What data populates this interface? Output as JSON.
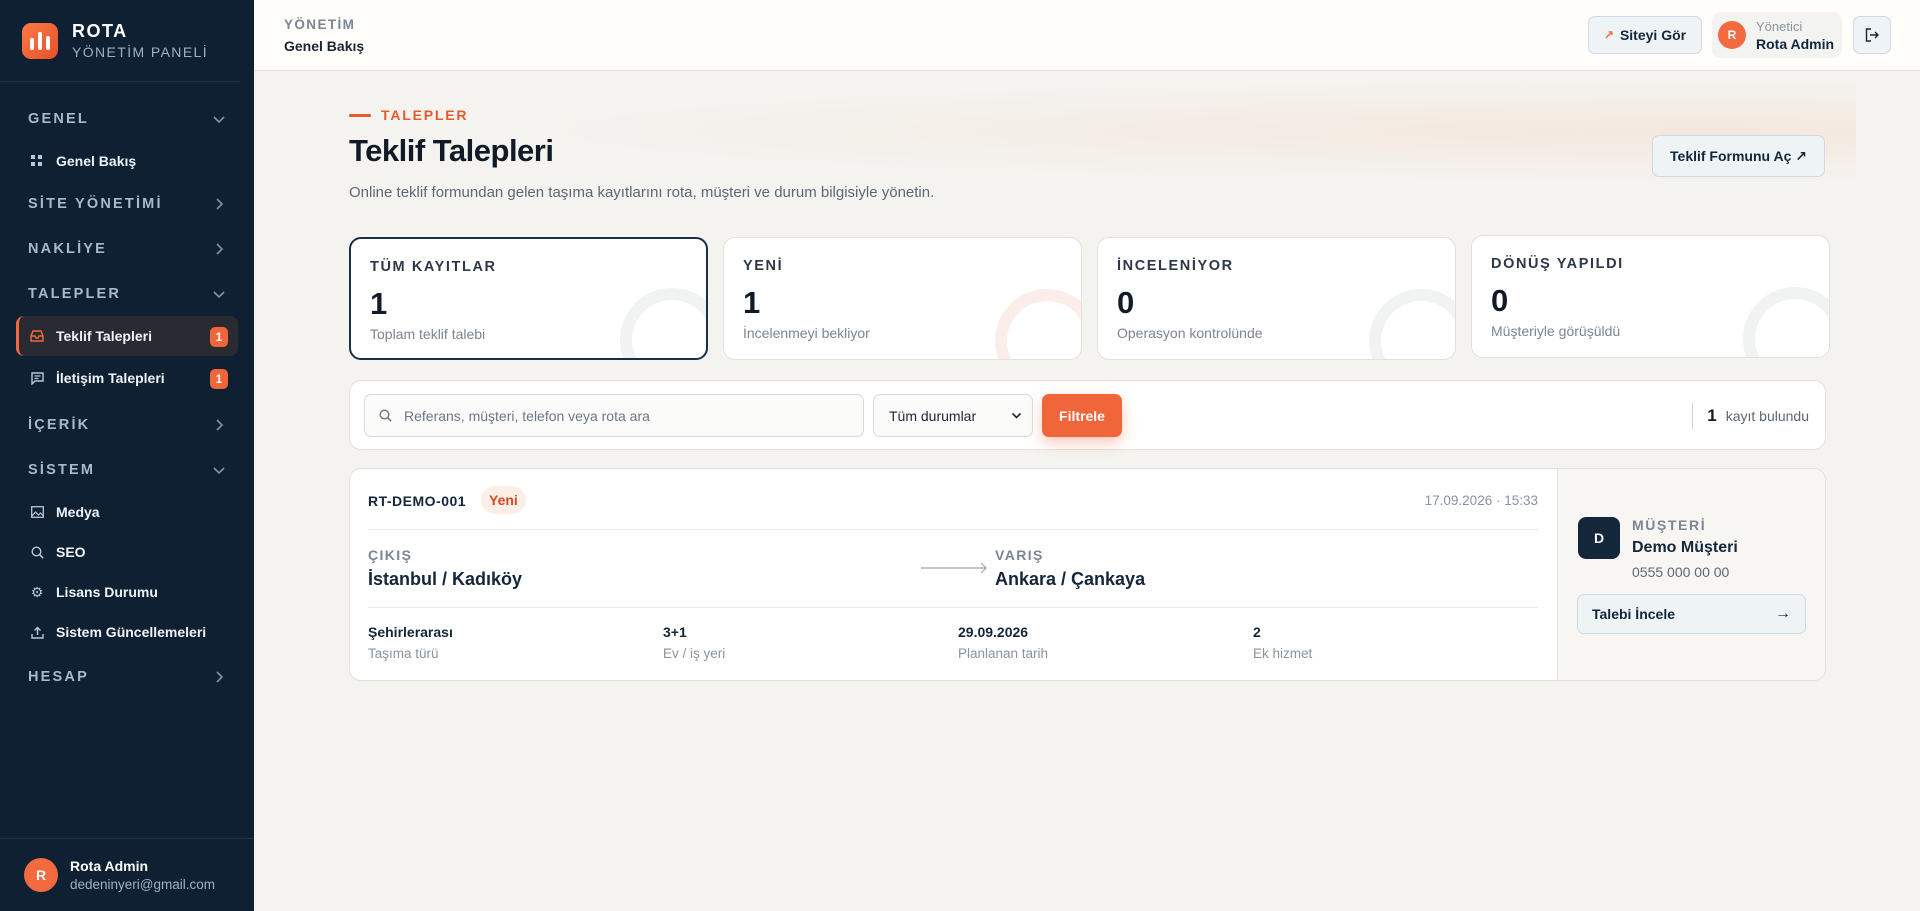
{
  "brand": {
    "name": "ROTA",
    "subtitle": "YÖNETİM PANELİ"
  },
  "sidebar": {
    "sections": [
      {
        "label": "GENEL",
        "expanded": true,
        "items": [
          {
            "label": "Genel Bakış",
            "icon": "grid-icon"
          }
        ]
      },
      {
        "label": "SİTE YÖNETİMİ",
        "expanded": false
      },
      {
        "label": "NAKLİYE",
        "expanded": false
      },
      {
        "label": "TALEPLER",
        "expanded": true,
        "items": [
          {
            "label": "Teklif Talepleri",
            "icon": "inbox-icon",
            "badge": "1",
            "active": true
          },
          {
            "label": "İletişim Talepleri",
            "icon": "message-icon",
            "badge": "1"
          }
        ]
      },
      {
        "label": "İÇERİK",
        "expanded": false
      },
      {
        "label": "SİSTEM",
        "expanded": true,
        "items": [
          {
            "label": "Medya",
            "icon": "image-icon"
          },
          {
            "label": "SEO",
            "icon": "search-icon"
          },
          {
            "label": "Lisans Durumu",
            "icon": "gear-icon"
          },
          {
            "label": "Sistem Güncellemeleri",
            "icon": "upload-icon"
          }
        ]
      },
      {
        "label": "HESAP",
        "expanded": false
      }
    ],
    "user": {
      "initial": "R",
      "name": "Rota Admin",
      "email": "dedeninyeri@gmail.com"
    }
  },
  "topbar": {
    "crumb_section": "YÖNETİM",
    "crumb_page": "Genel Bakış",
    "view_site": "Siteyi Gör",
    "role": "Yönetici",
    "admin_name": "Rota Admin",
    "admin_initial": "R"
  },
  "page": {
    "eyebrow": "TALEPLER",
    "title": "Teklif Talepleri",
    "description": "Online teklif formundan gelen taşıma kayıtlarını rota, müşteri ve durum bilgisiyle yönetin.",
    "open_form": "Teklif Formunu Aç ↗"
  },
  "stats": [
    {
      "label": "TÜM KAYITLAR",
      "value": "1",
      "sub": "Toplam teklif talebi",
      "selected": true
    },
    {
      "label": "YENİ",
      "value": "1",
      "sub": "İncelenmeyi bekliyor"
    },
    {
      "label": "İNCELENİYOR",
      "value": "0",
      "sub": "Operasyon kontrolünde"
    },
    {
      "label": "DÖNÜŞ YAPILDI",
      "value": "0",
      "sub": "Müşteriyle görüşüldü"
    }
  ],
  "filters": {
    "search_placeholder": "Referans, müşteri, telefon veya rota ara",
    "status_selected": "Tüm durumlar",
    "filter_button": "Filtrele",
    "count": "1",
    "count_label": "kayıt bulundu"
  },
  "request": {
    "ref": "RT-DEMO-001",
    "status": "Yeni",
    "datetime": "17.09.2026 · 15:33",
    "from_label": "ÇIKIŞ",
    "from": "İstanbul / Kadıköy",
    "to_label": "VARIŞ",
    "to": "Ankara / Çankaya",
    "meta": [
      {
        "value": "Şehirlerarası",
        "label": "Taşıma türü"
      },
      {
        "value": "3+1",
        "label": "Ev / iş yeri"
      },
      {
        "value": "29.09.2026",
        "label": "Planlanan tarih"
      },
      {
        "value": "2",
        "label": "Ek hizmet"
      }
    ],
    "customer_label": "MÜŞTERİ",
    "customer_initial": "D",
    "customer_name": "Demo Müşteri",
    "customer_phone": "0555 000 00 00",
    "detail_button": "Talebi İncele",
    "detail_arrow": "→"
  },
  "colors": {
    "accent": "#f0663a",
    "sidebar_bg": "#0f2033",
    "page_bg": "#f4f3ef"
  }
}
